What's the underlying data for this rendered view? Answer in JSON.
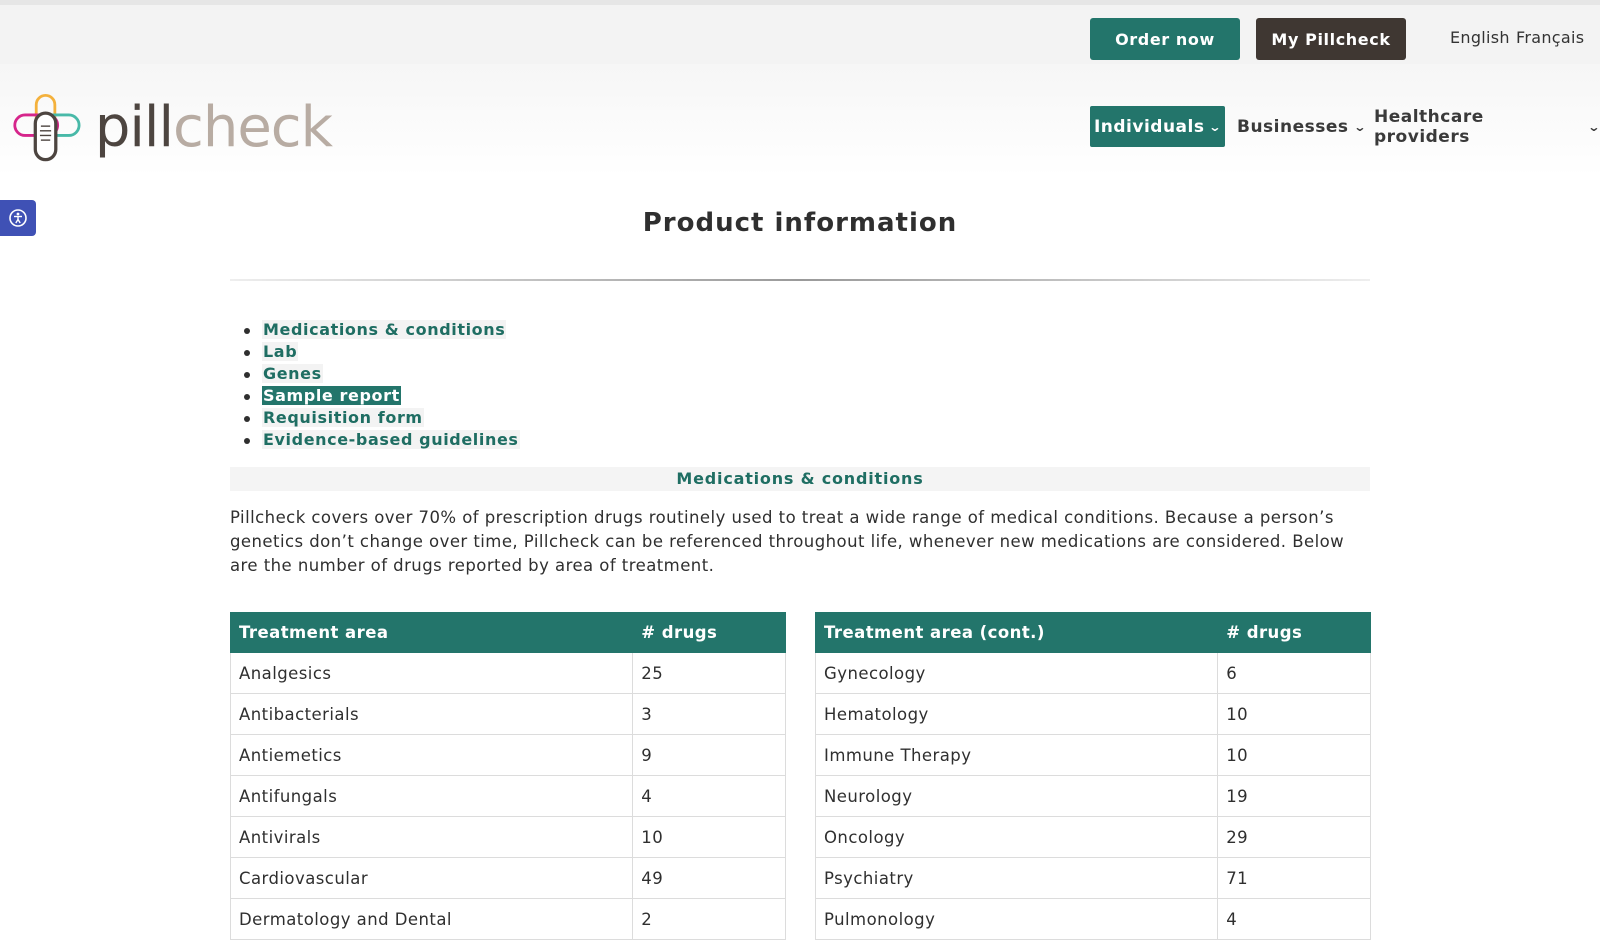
{
  "topbar": {
    "order_label": "Order now",
    "my_label": "My Pillcheck",
    "lang_en": "English",
    "lang_fr": "Français"
  },
  "header": {
    "logo_part1": "pill",
    "logo_part2": "check",
    "nav": {
      "individuals": "Individuals",
      "businesses": "Businesses",
      "healthcare": "Healthcare providers"
    },
    "icons": [
      "pillcheck-logo-icon",
      "chevron-down-icon",
      "accessibility-icon"
    ]
  },
  "colors": {
    "brand_green": "#23756b",
    "dark_brown": "#3f3732",
    "accessibility_blue": "#3f51b5"
  },
  "main": {
    "title": "Product information",
    "toc": [
      "Medications & conditions",
      "Lab",
      "Genes",
      "Sample report",
      "Requisition form",
      "Evidence-based guidelines"
    ],
    "active_toc": "Sample report",
    "section_title": "Medications & conditions",
    "intro": "Pillcheck covers over 70% of prescription drugs routinely used to treat a wide range of medical conditions. Because a person’s genetics don’t change over time, Pillcheck can be referenced throughout life, whenever new medications are considered. Below are the number of drugs reported by area of treatment.",
    "table1": {
      "headers": [
        "Treatment area",
        "# drugs"
      ],
      "rows": [
        [
          "Analgesics",
          "25"
        ],
        [
          "Antibacterials",
          "3"
        ],
        [
          "Antiemetics",
          "9"
        ],
        [
          "Antifungals",
          "4"
        ],
        [
          "Antivirals",
          "10"
        ],
        [
          "Cardiovascular",
          "49"
        ],
        [
          "Dermatology and Dental",
          "2"
        ]
      ]
    },
    "table2": {
      "headers": [
        "Treatment area (cont.)",
        "# drugs"
      ],
      "rows": [
        [
          "Gynecology",
          "6"
        ],
        [
          "Hematology",
          "10"
        ],
        [
          "Immune Therapy",
          "10"
        ],
        [
          "Neurology",
          "19"
        ],
        [
          "Oncology",
          "29"
        ],
        [
          "Psychiatry",
          "71"
        ],
        [
          "Pulmonology",
          "4"
        ]
      ]
    }
  }
}
